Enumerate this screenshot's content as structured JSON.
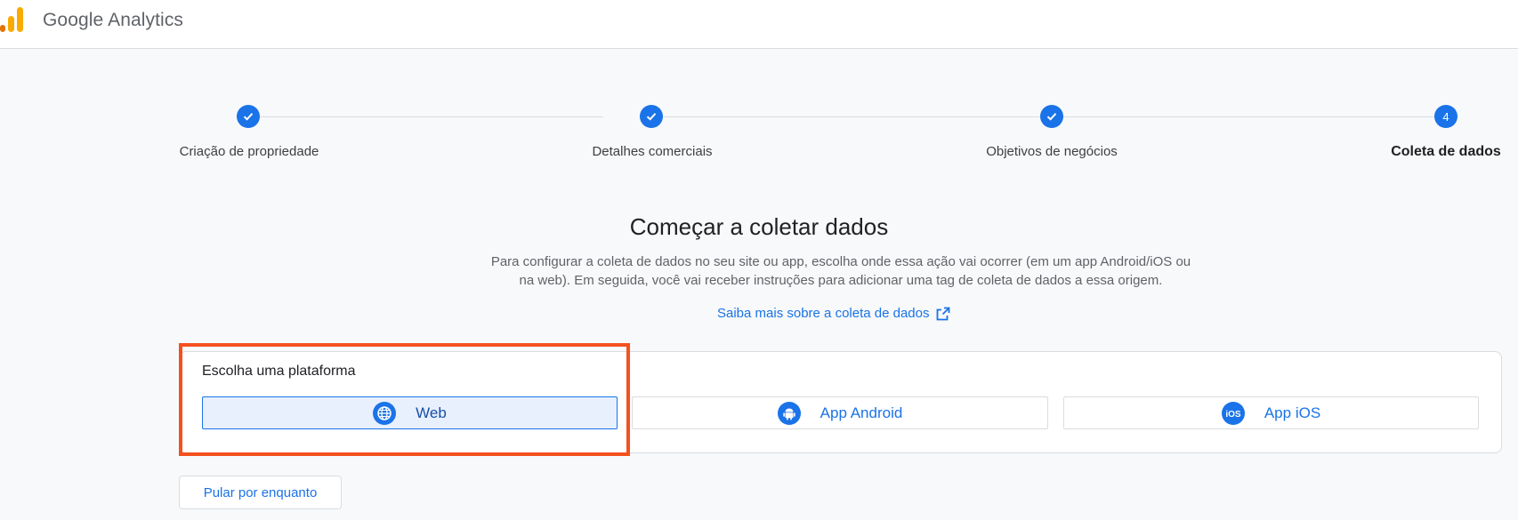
{
  "header": {
    "app_name": "Google Analytics",
    "logo_icon": "analytics-bars-icon"
  },
  "stepper": {
    "steps": [
      {
        "label": "Criação de propriedade",
        "status": "complete",
        "marker": "check"
      },
      {
        "label": "Detalhes comerciais",
        "status": "complete",
        "marker": "check"
      },
      {
        "label": "Objetivos de negócios",
        "status": "complete",
        "marker": "check"
      },
      {
        "label": "Coleta de dados",
        "status": "current",
        "marker": "4"
      }
    ]
  },
  "main": {
    "title": "Começar a coletar dados",
    "description_line1": "Para configurar a coleta de dados no seu site ou app, escolha onde essa ação vai ocorrer (em um app Android/iOS ou",
    "description_line2": "na web). Em seguida, você vai receber instruções para adicionar uma tag de coleta de dados a essa origem.",
    "learn_more_link": "Saiba mais sobre a coleta de dados"
  },
  "platform": {
    "title": "Escolha uma plataforma",
    "options": [
      {
        "label": "Web",
        "icon": "globe-icon",
        "selected": true
      },
      {
        "label": "App Android",
        "icon": "android-icon",
        "selected": false
      },
      {
        "label": "App iOS",
        "icon": "ios-icon",
        "selected": false
      }
    ]
  },
  "footer": {
    "skip_button": "Pular por enquanto"
  },
  "colors": {
    "primary": "#1a73e8",
    "highlight": "#f4511e",
    "selected_bg": "#e8f0fe"
  }
}
